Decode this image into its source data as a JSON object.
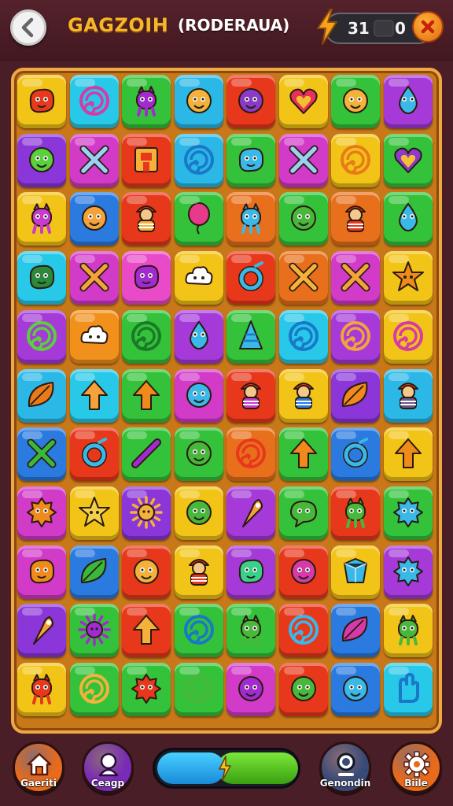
{
  "header": {
    "title": "GAGZOIH",
    "subtitle": "(RODERAUA)",
    "score": "31",
    "moves": "0"
  },
  "board": {
    "columns": 8,
    "rows": 11,
    "tiles": [
      {
        "color": "#f2c417",
        "icon": "blob",
        "icon_color": "#e83a1a"
      },
      {
        "color": "#27c8e8",
        "icon": "swirl",
        "icon_color": "#d63aa8"
      },
      {
        "color": "#34c23a",
        "icon": "creature",
        "icon_color": "#a32ad0"
      },
      {
        "color": "#2bb8e6",
        "icon": "face",
        "icon_color": "#f4b23a"
      },
      {
        "color": "#e8381c",
        "icon": "face",
        "icon_color": "#8c3ac8"
      },
      {
        "color": "#f2c417",
        "icon": "heart",
        "icon_color": "#e8305a"
      },
      {
        "color": "#34c23a",
        "icon": "face",
        "icon_color": "#f4b23a"
      },
      {
        "color": "#a53ad8",
        "icon": "drop",
        "icon_color": "#3ab8e8"
      },
      {
        "color": "#8a36d8",
        "icon": "face",
        "icon_color": "#5ad03a"
      },
      {
        "color": "#d23ac8",
        "icon": "cross",
        "icon_color": "#9ad0f0"
      },
      {
        "color": "#e8381c",
        "icon": "box",
        "icon_color": "#f4b23a"
      },
      {
        "color": "#2bb8e6",
        "icon": "swirl",
        "icon_color": "#1a78c8"
      },
      {
        "color": "#34c23a",
        "icon": "blob",
        "icon_color": "#3ab8e8"
      },
      {
        "color": "#d23ac8",
        "icon": "cross",
        "icon_color": "#9ad0f0"
      },
      {
        "color": "#f2c417",
        "icon": "swirl",
        "icon_color": "#e87a1a"
      },
      {
        "color": "#34c23a",
        "icon": "heart",
        "icon_color": "#8c3ac8"
      },
      {
        "color": "#f2c417",
        "icon": "creature",
        "icon_color": "#c83ad0"
      },
      {
        "color": "#2a7ae0",
        "icon": "face",
        "icon_color": "#f4a23a"
      },
      {
        "color": "#e8381c",
        "icon": "person",
        "icon_color": "#f4b23a"
      },
      {
        "color": "#34c23a",
        "icon": "balloon",
        "icon_color": "#e83a8a"
      },
      {
        "color": "#e8701c",
        "icon": "creature",
        "icon_color": "#3ab8e8"
      },
      {
        "color": "#34c23a",
        "icon": "face",
        "icon_color": "#48b83a"
      },
      {
        "color": "#e8701c",
        "icon": "person",
        "icon_color": "#e8381c"
      },
      {
        "color": "#34c23a",
        "icon": "drop",
        "icon_color": "#3ab8e8"
      },
      {
        "color": "#27c8e8",
        "icon": "blob",
        "icon_color": "#2a8a3a"
      },
      {
        "color": "#d23ac8",
        "icon": "cross",
        "icon_color": "#f4a23a"
      },
      {
        "color": "#e84ac8",
        "icon": "blob",
        "icon_color": "#a32ad0"
      },
      {
        "color": "#f2c417",
        "icon": "cloud",
        "icon_color": "#ffffff"
      },
      {
        "color": "#e8381c",
        "icon": "ring",
        "icon_color": "#3ab8e8"
      },
      {
        "color": "#e8701c",
        "icon": "cross",
        "icon_color": "#f4b23a"
      },
      {
        "color": "#d23ac8",
        "icon": "cross",
        "icon_color": "#f4a23a"
      },
      {
        "color": "#f2c417",
        "icon": "star",
        "icon_color": "#f08a1a"
      },
      {
        "color": "#a53ad8",
        "icon": "swirl",
        "icon_color": "#5ad03a"
      },
      {
        "color": "#f2901c",
        "icon": "cloud",
        "icon_color": "#ffffff"
      },
      {
        "color": "#34c23a",
        "icon": "swirl",
        "icon_color": "#1a7a28"
      },
      {
        "color": "#a53ad8",
        "icon": "drop",
        "icon_color": "#3ab8e8"
      },
      {
        "color": "#34c23a",
        "icon": "cone",
        "icon_color": "#3ab8e8"
      },
      {
        "color": "#27c8e8",
        "icon": "swirl",
        "icon_color": "#1a78c8"
      },
      {
        "color": "#a53ad8",
        "icon": "swirl",
        "icon_color": "#f4a23a"
      },
      {
        "color": "#f2c417",
        "icon": "swirl",
        "icon_color": "#d63aa8"
      },
      {
        "color": "#2bb8e6",
        "icon": "leaf",
        "icon_color": "#e87a1a"
      },
      {
        "color": "#27c8e8",
        "icon": "arrow",
        "icon_color": "#f4a23a"
      },
      {
        "color": "#34c23a",
        "icon": "arrow",
        "icon_color": "#f08a1a"
      },
      {
        "color": "#d23ac8",
        "icon": "face",
        "icon_color": "#3ab8e8"
      },
      {
        "color": "#e8381c",
        "icon": "person",
        "icon_color": "#c83ad0"
      },
      {
        "color": "#f2c417",
        "icon": "person",
        "icon_color": "#2a7ae0"
      },
      {
        "color": "#8a36d8",
        "icon": "leaf",
        "icon_color": "#f08a1a"
      },
      {
        "color": "#2bb8e6",
        "icon": "person",
        "icon_color": "#6a5a8a"
      },
      {
        "color": "#2a7ae0",
        "icon": "cross",
        "icon_color": "#3ab83a"
      },
      {
        "color": "#e8381c",
        "icon": "ring",
        "icon_color": "#3ab8e8"
      },
      {
        "color": "#34c23a",
        "icon": "stick",
        "icon_color": "#a32ad0"
      },
      {
        "color": "#34c23a",
        "icon": "face",
        "icon_color": "#48b83a"
      },
      {
        "color": "#e8701c",
        "icon": "swirl",
        "icon_color": "#e8381c"
      },
      {
        "color": "#34c23a",
        "icon": "arrow",
        "icon_color": "#f08a1a"
      },
      {
        "color": "#2a7ae0",
        "icon": "ring",
        "icon_color": "#3ab8e8"
      },
      {
        "color": "#f2c417",
        "icon": "arrow",
        "icon_color": "#f08a1a"
      },
      {
        "color": "#d23ac8",
        "icon": "splat",
        "icon_color": "#f08a1a"
      },
      {
        "color": "#f2c417",
        "icon": "star",
        "icon_color": "#f4d04a"
      },
      {
        "color": "#8a36d8",
        "icon": "sun",
        "icon_color": "#f4b23a"
      },
      {
        "color": "#f2c417",
        "icon": "face",
        "icon_color": "#48b83a"
      },
      {
        "color": "#a53ad8",
        "icon": "pin",
        "icon_color": "#f4a23a"
      },
      {
        "color": "#34c23a",
        "icon": "bubble",
        "icon_color": "#48b83a"
      },
      {
        "color": "#e8381c",
        "icon": "creature",
        "icon_color": "#48b83a"
      },
      {
        "color": "#34c23a",
        "icon": "splat",
        "icon_color": "#3ab8e8"
      },
      {
        "color": "#d23ac8",
        "icon": "blob",
        "icon_color": "#f08a1a"
      },
      {
        "color": "#2a7ae0",
        "icon": "leaf",
        "icon_color": "#3ab83a"
      },
      {
        "color": "#e8381c",
        "icon": "face",
        "icon_color": "#f4b23a"
      },
      {
        "color": "#f2c417",
        "icon": "person",
        "icon_color": "#e8381c"
      },
      {
        "color": "#a53ad8",
        "icon": "blob",
        "icon_color": "#3ad08a"
      },
      {
        "color": "#e8381c",
        "icon": "face",
        "icon_color": "#d63aa8"
      },
      {
        "color": "#f2c417",
        "icon": "gem",
        "icon_color": "#3ab8e8"
      },
      {
        "color": "#a53ad8",
        "icon": "splat",
        "icon_color": "#3ab8e8"
      },
      {
        "color": "#8a36d8",
        "icon": "pin",
        "icon_color": "#f4a23a"
      },
      {
        "color": "#34c23a",
        "icon": "sun",
        "icon_color": "#a32ad0"
      },
      {
        "color": "#e8381c",
        "icon": "arrow",
        "icon_color": "#f4b23a"
      },
      {
        "color": "#34c23a",
        "icon": "swirl",
        "icon_color": "#1a78c8"
      },
      {
        "color": "#34c23a",
        "icon": "creature",
        "icon_color": "#48b83a"
      },
      {
        "color": "#e8381c",
        "icon": "swirl",
        "icon_color": "#3ab8e8"
      },
      {
        "color": "#2a7ae0",
        "icon": "leaf",
        "icon_color": "#d63aa8"
      },
      {
        "color": "#f2c417",
        "icon": "creature",
        "icon_color": "#48b83a"
      },
      {
        "color": "#f2c417",
        "icon": "creature",
        "icon_color": "#e8381c"
      },
      {
        "color": "#34c23a",
        "icon": "swirl",
        "icon_color": "#f4b23a"
      },
      {
        "color": "#34c23a",
        "icon": "splat",
        "icon_color": "#e8381c"
      },
      {
        "color": "#34c23a",
        "icon": "swirl",
        "icon_color": "#48b83a"
      },
      {
        "color": "#d23ac8",
        "icon": "face",
        "icon_color": "#a32ad0"
      },
      {
        "color": "#e8381c",
        "icon": "face",
        "icon_color": "#48b83a"
      },
      {
        "color": "#2a7ae0",
        "icon": "face",
        "icon_color": "#3ab8e8"
      },
      {
        "color": "#27c8e8",
        "icon": "hand",
        "icon_color": "#1a78c8"
      }
    ]
  },
  "bottom": {
    "buttons": [
      {
        "label": "Gaeriti",
        "icon": "home-icon",
        "color": "#e86a1a"
      },
      {
        "label": "Ceagp",
        "icon": "profile-icon",
        "color": "#7a2ab8"
      },
      {
        "label": "Genondin",
        "icon": "search-icon",
        "color": "#3a4a78"
      },
      {
        "label": "Biile",
        "icon": "gear-icon",
        "color": "#e86a1a"
      }
    ],
    "progress_fraction": 0.47
  }
}
